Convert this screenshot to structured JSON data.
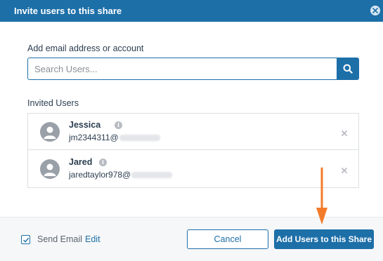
{
  "dialog": {
    "title": "Invite users to this share",
    "close_icon": "close-circle-icon"
  },
  "search": {
    "label": "Add email address or account",
    "placeholder": "Search Users...",
    "value": "",
    "button_icon": "search-icon"
  },
  "invited": {
    "label": "Invited Users",
    "users": [
      {
        "name": "Jessica",
        "email": "jm2344311@",
        "info_icon": "info-icon",
        "remove_icon": "close-icon",
        "avatar_icon": "user-avatar-icon"
      },
      {
        "name": "Jared",
        "email": "jaredtaylor978@",
        "info_icon": "info-icon",
        "remove_icon": "close-icon",
        "avatar_icon": "user-avatar-icon"
      }
    ]
  },
  "footer": {
    "send_email_label": "Send Email",
    "send_email_checked": true,
    "edit_label": "Edit",
    "cancel_label": "Cancel",
    "add_label": "Add Users to this Share"
  },
  "annotation": {
    "arrow_icon": "arrow-down-icon",
    "arrow_color": "#f47b2a"
  },
  "colors": {
    "primary": "#1d6fa8",
    "text": "#2c3e50",
    "border": "#dcdfe3"
  }
}
